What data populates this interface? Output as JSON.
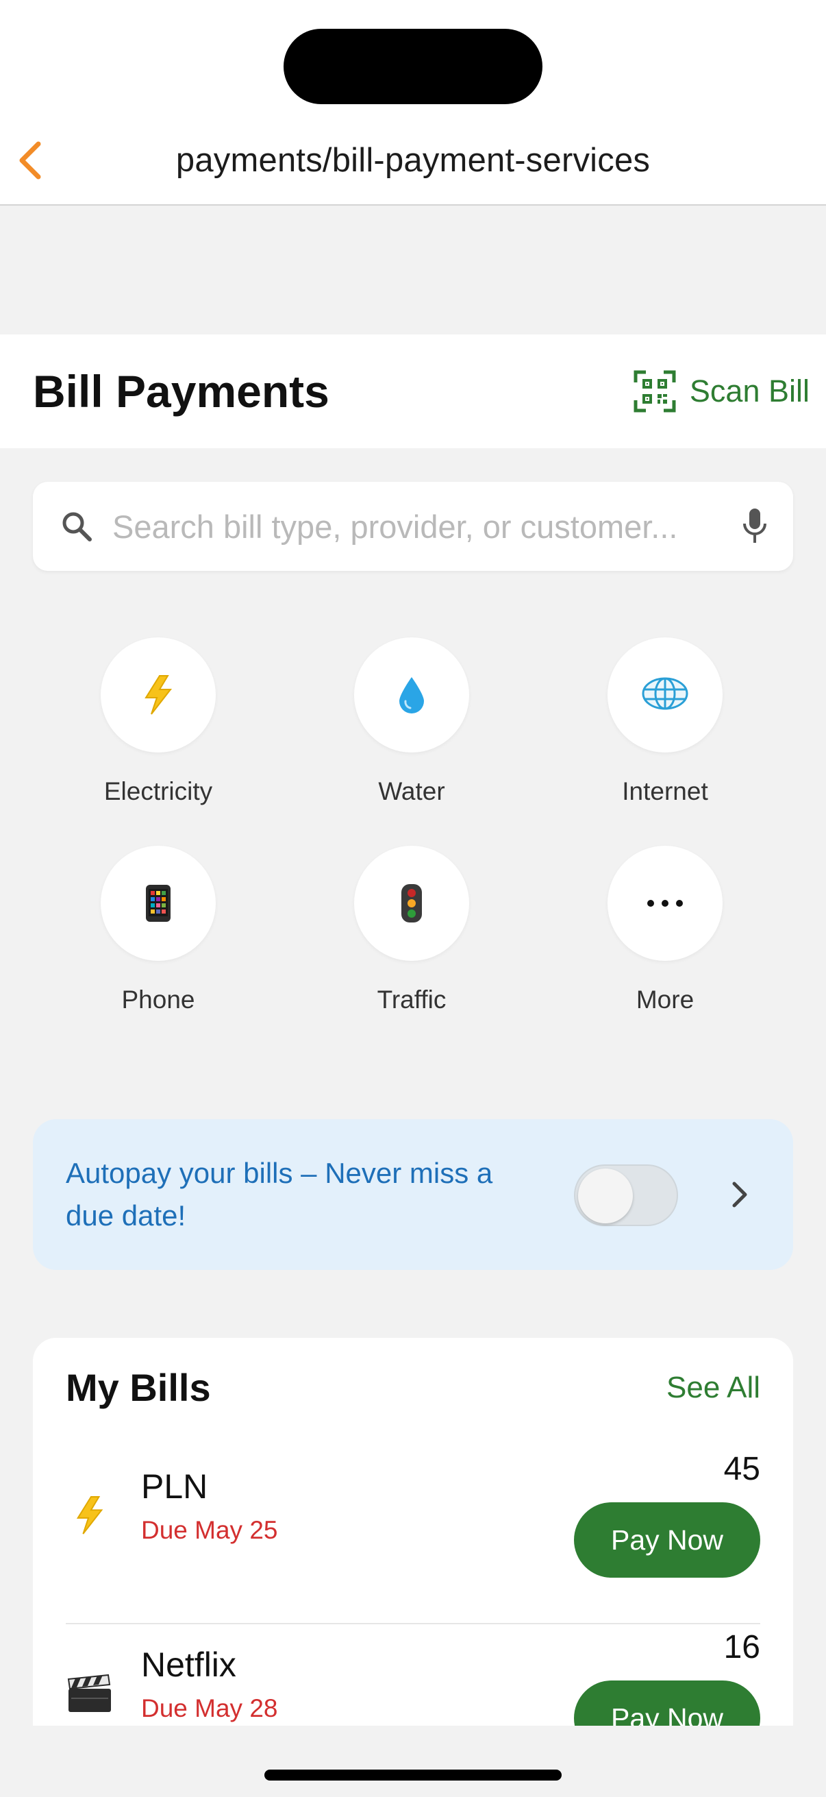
{
  "nav": {
    "url_title": "payments/bill-payment-services",
    "back_icon": "chevron-left-icon"
  },
  "header": {
    "title": "Bill Payments",
    "scan_label": "Scan Bill",
    "scan_icon": "qr-scan-icon"
  },
  "search": {
    "placeholder": "Search bill type, provider, or customer...",
    "value": "",
    "search_icon": "search-icon",
    "mic_icon": "microphone-icon"
  },
  "categories": [
    {
      "label": "Electricity",
      "icon": "lightning-icon"
    },
    {
      "label": "Water",
      "icon": "water-drop-icon"
    },
    {
      "label": "Internet",
      "icon": "globe-icon"
    },
    {
      "label": "Phone",
      "icon": "mobile-phone-icon"
    },
    {
      "label": "Traffic",
      "icon": "traffic-light-icon"
    },
    {
      "label": "More",
      "icon": "more-dots-icon"
    }
  ],
  "autopay": {
    "text": "Autopay your bills – Never miss a due date!",
    "enabled": false
  },
  "bills": {
    "title": "My Bills",
    "see_all": "See All",
    "items": [
      {
        "name": "PLN",
        "due": "Due May 25",
        "amount": "45",
        "action": "Pay Now",
        "icon": "lightning-icon"
      },
      {
        "name": "Netflix",
        "due": "Due May 28",
        "amount": "16",
        "action": "Pay Now",
        "icon": "clapperboard-icon"
      }
    ]
  },
  "colors": {
    "accent_green": "#2e7d32",
    "back_orange": "#f28c28",
    "autopay_bg": "#e3f0fb",
    "autopay_text": "#1e6fb8",
    "due_red": "#d32f2f"
  }
}
